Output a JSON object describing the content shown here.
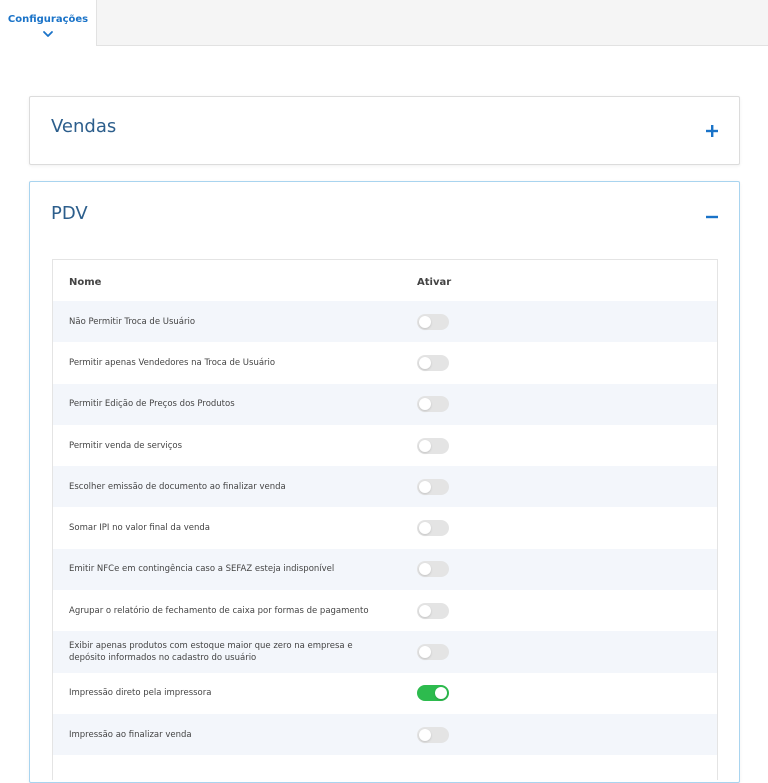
{
  "tabs": {
    "active_label": "Configurações"
  },
  "sections": {
    "vendas": {
      "title": "Vendas"
    },
    "pdv": {
      "title": "PDV"
    }
  },
  "table": {
    "headers": {
      "name": "Nome",
      "activate": "Ativar"
    },
    "rows": [
      {
        "label": "Não Permitir Troca de Usuário",
        "enabled": false
      },
      {
        "label": "Permitir apenas Vendedores na Troca de Usuário",
        "enabled": false
      },
      {
        "label": "Permitir Edição de Preços dos Produtos",
        "enabled": false
      },
      {
        "label": "Permitir venda de serviços",
        "enabled": false
      },
      {
        "label": "Escolher emissão de documento ao finalizar venda",
        "enabled": false
      },
      {
        "label": "Somar IPI no valor final da venda",
        "enabled": false
      },
      {
        "label": "Emitir NFCe em contingência caso a SEFAZ esteja indisponível",
        "enabled": false
      },
      {
        "label": "Agrupar o relatório de fechamento de caixa por formas de pagamento",
        "enabled": false
      },
      {
        "label": "Exibir apenas produtos com estoque maior que zero na empresa e depósito informados no cadastro do usuário",
        "enabled": false
      },
      {
        "label": "Impressão direto pela impressora",
        "enabled": true
      },
      {
        "label": "Impressão ao finalizar venda",
        "enabled": false
      }
    ]
  },
  "colors": {
    "accent": "#1a73c8",
    "switch_on": "#2dbb4e",
    "switch_off": "#e4e4e4"
  }
}
